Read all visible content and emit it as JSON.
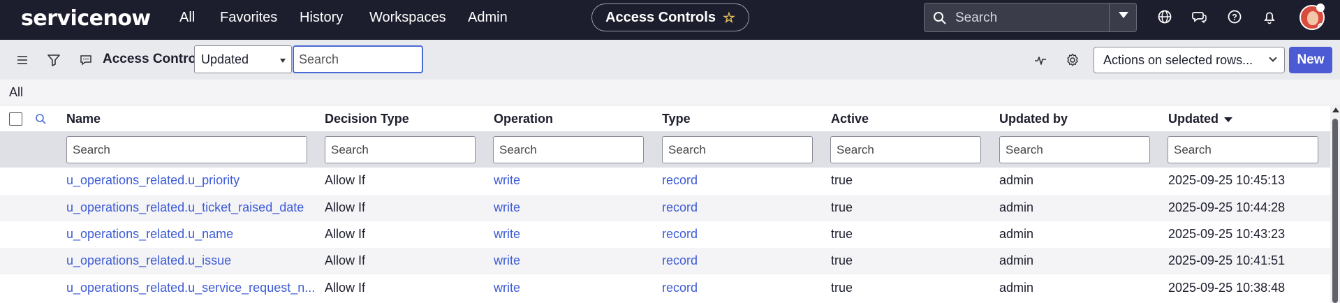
{
  "topnav": {
    "logo": "servicenow",
    "items": [
      "All",
      "Favorites",
      "History",
      "Workspaces",
      "Admin"
    ],
    "page_title": "Access Controls",
    "search_placeholder": "Search",
    "icons": [
      "globe-icon",
      "chat-icon",
      "help-icon",
      "bell-icon"
    ]
  },
  "toolbar": {
    "title": "Access Controls",
    "field_select": "Updated",
    "search_placeholder": "Search",
    "actions_select": "Actions on selected rows...",
    "new_label": "New"
  },
  "breadcrumb": "All",
  "table": {
    "columns": [
      "Name",
      "Decision Type",
      "Operation",
      "Type",
      "Active",
      "Updated by",
      "Updated"
    ],
    "sorted_column": "Updated",
    "filter_placeholder": "Search",
    "rows": [
      {
        "name": "u_operations_related.u_priority",
        "decision_type": "Allow If",
        "operation": "write",
        "type": "record",
        "active": "true",
        "updated_by": "admin",
        "updated": "2025-09-25 10:45:13"
      },
      {
        "name": "u_operations_related.u_ticket_raised_date",
        "decision_type": "Allow If",
        "operation": "write",
        "type": "record",
        "active": "true",
        "updated_by": "admin",
        "updated": "2025-09-25 10:44:28"
      },
      {
        "name": "u_operations_related.u_name",
        "decision_type": "Allow If",
        "operation": "write",
        "type": "record",
        "active": "true",
        "updated_by": "admin",
        "updated": "2025-09-25 10:43:23"
      },
      {
        "name": "u_operations_related.u_issue",
        "decision_type": "Allow If",
        "operation": "write",
        "type": "record",
        "active": "true",
        "updated_by": "admin",
        "updated": "2025-09-25 10:41:51"
      },
      {
        "name": "u_operations_related.u_service_request_n...",
        "decision_type": "Allow If",
        "operation": "write",
        "type": "record",
        "active": "true",
        "updated_by": "admin",
        "updated": "2025-09-25 10:38:48"
      }
    ]
  },
  "colors": {
    "nav_bg": "#1c1e2d",
    "link": "#3d5bd6",
    "primary_button": "#4c5bd4",
    "toolbar_bg": "#e9eaee"
  }
}
